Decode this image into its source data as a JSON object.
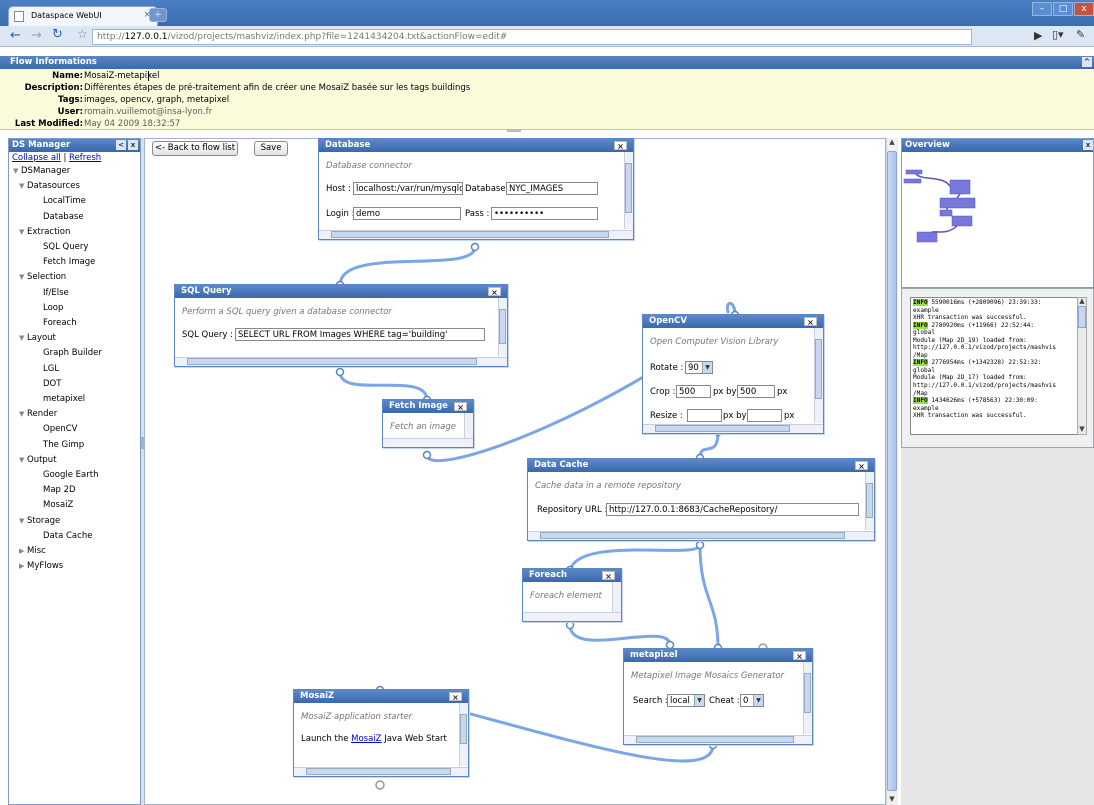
{
  "browser": {
    "tab_title": "Dataspace WebUI",
    "tab_close": "×",
    "new_tab": "+",
    "url_prefix": "http://",
    "url_host": "127.0.0.1",
    "url_path": "/vizod/projects/mashviz/index.php?file=1241434204.txt&actionFlow=edit#",
    "window_buttons": [
      "–",
      "□",
      "x"
    ]
  },
  "flow_info": {
    "title": "Flow Informations",
    "fields": [
      {
        "key": "Name:",
        "value": "MosaiZ-metapixel"
      },
      {
        "key": "Description:",
        "value": "Différentes étapes de pré-traitement afin de créer une MosaiZ basée sur les tags buildings"
      },
      {
        "key": "Tags:",
        "value": "images, opencv, graph, metapixel"
      },
      {
        "key": "User:",
        "value": "romain.vuillemot@insa-lyon.fr"
      },
      {
        "key": "Last Modified:",
        "value": "May 04 2009 18:32:57"
      }
    ]
  },
  "ds_manager": {
    "title": "DS Manager",
    "collapse_label": "Collapse all",
    "separator": " | ",
    "refresh_label": "Refresh",
    "tree": [
      {
        "label": "DSManager",
        "level": 0,
        "expanded": true
      },
      {
        "label": "Datasources",
        "level": 1,
        "expanded": true
      },
      {
        "label": "LocalTime",
        "level": 2
      },
      {
        "label": "Database",
        "level": 2
      },
      {
        "label": "Extraction",
        "level": 1,
        "expanded": true
      },
      {
        "label": "SQL Query",
        "level": 2
      },
      {
        "label": "Fetch Image",
        "level": 2
      },
      {
        "label": "Selection",
        "level": 1,
        "expanded": true
      },
      {
        "label": "If/Else",
        "level": 2
      },
      {
        "label": "Loop",
        "level": 2
      },
      {
        "label": "Foreach",
        "level": 2
      },
      {
        "label": "Layout",
        "level": 1,
        "expanded": true
      },
      {
        "label": "Graph Builder",
        "level": 2
      },
      {
        "label": "LGL",
        "level": 2
      },
      {
        "label": "DOT",
        "level": 2
      },
      {
        "label": "metapixel",
        "level": 2
      },
      {
        "label": "Render",
        "level": 1,
        "expanded": true
      },
      {
        "label": "OpenCV",
        "level": 2
      },
      {
        "label": "The Gimp",
        "level": 2
      },
      {
        "label": "Output",
        "level": 1,
        "expanded": true
      },
      {
        "label": "Google Earth",
        "level": 2
      },
      {
        "label": "Map 2D",
        "level": 2
      },
      {
        "label": "MosaiZ",
        "level": 2
      },
      {
        "label": "Storage",
        "level": 1,
        "expanded": true
      },
      {
        "label": "Data Cache",
        "level": 2
      },
      {
        "label": "Misc",
        "level": 1,
        "expanded": false
      },
      {
        "label": "MyFlows",
        "level": 1,
        "expanded": false
      }
    ]
  },
  "canvas": {
    "back_label": "<- Back to flow list",
    "save_label": "Save"
  },
  "modules": {
    "database": {
      "title": "Database",
      "desc": "Database connector",
      "host_label": "Host :",
      "host_value": "localhost:/var/run/mysqld_",
      "db_label": "Database :",
      "db_value": "NYC_IMAGES",
      "login_label": "Login :",
      "login_value": "demo",
      "pass_label": "Pass :",
      "pass_value": "••••••••••"
    },
    "sql_query": {
      "title": "SQL Query",
      "desc": "Perform a SQL query given a database connector",
      "query_label": "SQL Query :",
      "query_value": "SELECT URL FROM Images WHERE tag='building'"
    },
    "fetch_image": {
      "title": "Fetch Image",
      "desc": "Fetch an image"
    },
    "opencv": {
      "title": "OpenCV",
      "desc": "Open Computer Vision Library",
      "rotate_label": "Rotate :",
      "rotate_value": "90",
      "crop_label": "Crop :",
      "crop_w": "500",
      "px_by": "px by",
      "crop_h": "500",
      "px": "px",
      "resize_label": "Resize :",
      "resize_w": "",
      "resize_h": ""
    },
    "data_cache": {
      "title": "Data Cache",
      "desc": "Cache data in a remote repository",
      "url_label": "Repository URL :",
      "url_value": "http://127.0.0.1:8683/CacheRepository/"
    },
    "foreach": {
      "title": "Foreach",
      "desc": "Foreach element"
    },
    "metapixel": {
      "title": "metapixel",
      "desc": "Metapixel Image Mosaics Generator",
      "search_label": "Search :",
      "search_value": "local",
      "cheat_label": "Cheat :",
      "cheat_value": "0"
    },
    "mosaiz": {
      "title": "MosaiZ",
      "desc": "MosaiZ application starter",
      "launch_pre": "Launch the ",
      "launch_link": "MosaiZ",
      "launch_post": " Java Web Start"
    }
  },
  "overview": {
    "title": "Overview",
    "close": "x"
  },
  "log": {
    "lines": [
      {
        "tag": "INFO",
        "text": " 5590016ms (+2809096) 23:39:33:"
      },
      {
        "text": "example"
      },
      {
        "text": "XHR transaction was successful."
      },
      {
        "tag": "INFO",
        "text": " 2780920ms (+11966) 22:52:44:"
      },
      {
        "text": "global"
      },
      {
        "text": "Module (Map 2D_19) loaded from:"
      },
      {
        "text": "http://127.0.0.1/vizod/projects/mashvis"
      },
      {
        "text": "/Map"
      },
      {
        "tag": "INFO",
        "text": " 2776954ms (+1342328) 22:52:32:"
      },
      {
        "text": "global"
      },
      {
        "text": "Module (Map 2D_17) loaded from:"
      },
      {
        "text": "http://127.0.0.1/vizod/projects/mashvis"
      },
      {
        "text": "/Map"
      },
      {
        "tag": "INFO",
        "text": " 1434626ms (+578563) 22:30:09:"
      },
      {
        "text": "example"
      },
      {
        "text": "XHR transaction was successful."
      }
    ]
  },
  "colors": {
    "header_blue": "#3b68ad",
    "wire": "#7aa6e6",
    "info_badge": "#9adf46",
    "flowinfo_bg": "#fbfbdc"
  }
}
